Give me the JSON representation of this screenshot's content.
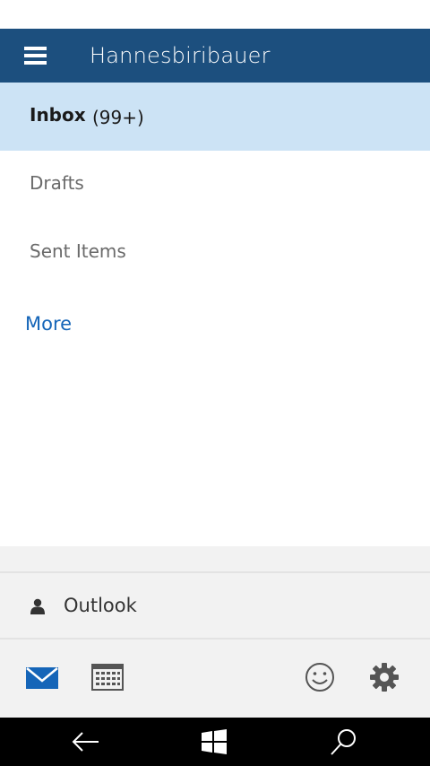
{
  "header": {
    "account_name": "Hannesbiribauer",
    "menu_icon": "hamburger-menu-icon"
  },
  "folders": [
    {
      "label": "Inbox",
      "count": "(99+)",
      "selected": true
    },
    {
      "label": "Drafts",
      "count": "",
      "selected": false
    },
    {
      "label": "Sent Items",
      "count": "",
      "selected": false
    }
  ],
  "more_link": "More",
  "account_switcher": {
    "label": "Outlook",
    "icon": "person-icon"
  },
  "app_bar": {
    "mail_icon": "mail-icon",
    "calendar_icon": "calendar-icon",
    "feedback_icon": "smiley-icon",
    "settings_icon": "gear-icon"
  },
  "system_nav": {
    "back_icon": "back-arrow-icon",
    "start_icon": "windows-logo-icon",
    "search_icon": "search-icon"
  },
  "colors": {
    "header_bg": "#1c4f7e",
    "selected_bg": "#cce3f5",
    "accent": "#1565b8"
  }
}
